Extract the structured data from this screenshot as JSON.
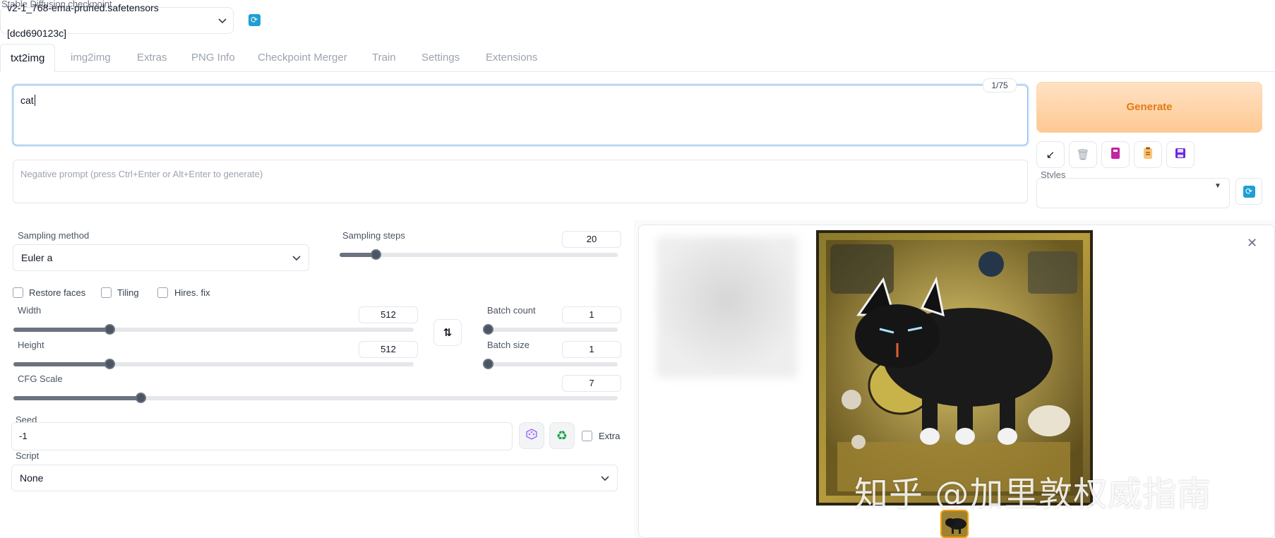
{
  "checkpoint": {
    "label": "Stable Diffusion checkpoint",
    "value": "v2-1_768-ema-pruned.safetensors [dcd690123c]"
  },
  "tabs": [
    {
      "label": "txt2img",
      "active": true
    },
    {
      "label": "img2img"
    },
    {
      "label": "Extras"
    },
    {
      "label": "PNG Info"
    },
    {
      "label": "Checkpoint Merger"
    },
    {
      "label": "Train"
    },
    {
      "label": "Settings"
    },
    {
      "label": "Extensions"
    }
  ],
  "prompt": {
    "value": "cat",
    "token_count": "1/75"
  },
  "negative_prompt": {
    "placeholder": "Negative prompt (press Ctrl+Enter or Alt+Enter to generate)"
  },
  "generate": {
    "label": "Generate"
  },
  "toolbar": {
    "icons": [
      "arrow-down-left-icon",
      "trash-icon",
      "book-icon",
      "clipboard-icon",
      "save-icon"
    ]
  },
  "styles": {
    "label": "Styles",
    "value": ""
  },
  "sampling": {
    "method_label": "Sampling method",
    "method_value": "Euler a",
    "steps_label": "Sampling steps",
    "steps_value": "20",
    "steps_fraction": 0.13
  },
  "checkboxes": {
    "restore_faces": "Restore faces",
    "tiling": "Tiling",
    "hires_fix": "Hires. fix",
    "extra": "Extra"
  },
  "dimensions": {
    "width_label": "Width",
    "width_value": "512",
    "width_fraction": 0.24,
    "height_label": "Height",
    "height_value": "512",
    "height_fraction": 0.24
  },
  "batch": {
    "count_label": "Batch count",
    "count_value": "1",
    "count_fraction": 0.0,
    "size_label": "Batch size",
    "size_value": "1",
    "size_fraction": 0.0
  },
  "cfg": {
    "label": "CFG Scale",
    "value": "7",
    "fraction": 0.21
  },
  "seed": {
    "label": "Seed",
    "value": "-1"
  },
  "script": {
    "label": "Script",
    "value": "None"
  },
  "gallery": {
    "watermark": "知乎 @加里敦权威指南"
  },
  "colors": {
    "accent": "#1e9fd6",
    "generate_bg": "#ffcf9f",
    "generate_text": "#e07b17"
  }
}
